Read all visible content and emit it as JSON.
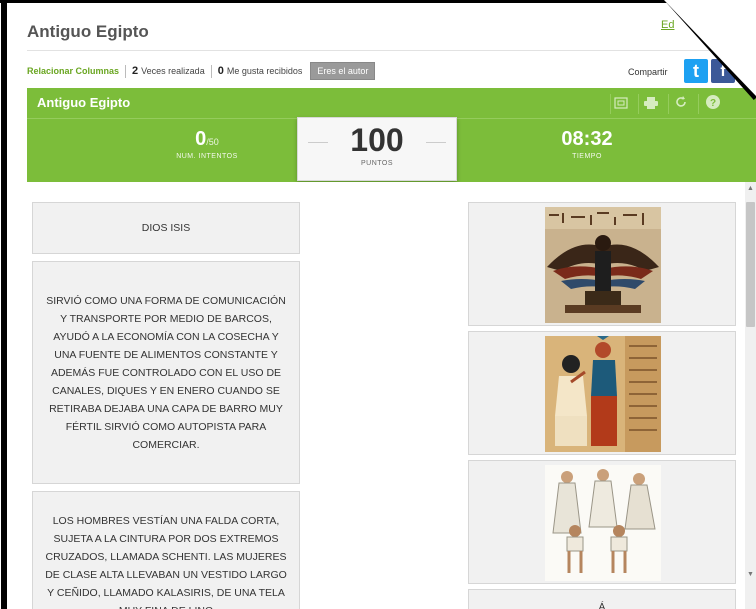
{
  "page": {
    "title": "Antiguo Egipto",
    "edit_link": "Ed"
  },
  "meta": {
    "activity_type": "Relacionar Columnas",
    "times_done": "2",
    "times_done_label": "Veces realizada",
    "likes": "0",
    "likes_label": "Me gusta recibidos",
    "author_button": "Eres el autor"
  },
  "share": {
    "label": "Compartir",
    "twitter_icon": "twitter-icon",
    "facebook_icon": "facebook-icon"
  },
  "game": {
    "title": "Antiguo Egipto",
    "attempts": {
      "value": "0",
      "max": "/50",
      "label": "NUM. INTENTOS"
    },
    "score": {
      "value": "100",
      "label": "PUNTOS"
    },
    "time": {
      "value": "08:32",
      "label": "TIEMPO"
    },
    "icons": [
      "fullscreen-icon",
      "print-icon",
      "restart-icon",
      "help-icon"
    ]
  },
  "left_column": [
    {
      "text": "DIOS ISIS"
    },
    {
      "text": "SIRVIÓ COMO UNA FORMA DE COMUNICACIÓN Y TRANSPORTE POR MEDIO DE BARCOS, AYUDÓ A LA ECONOMÍA CON LA COSECHA Y UNA FUENTE DE ALIMENTOS CONSTANTE Y ADEMÁS FUE CONTROLADO CON EL USO DE CANALES, DIQUES Y EN ENERO CUANDO SE RETIRABA DEJABA UNA CAPA DE BARRO MUY FÉRTIL SIRVIÓ COMO AUTOPISTA PARA COMERCIAR."
    },
    {
      "text": "LOS HOMBRES VESTÍAN UNA FALDA CORTA, SUJETA A LA CINTURA POR DOS EXTREMOS CRUZADOS, LLAMADA SCHENTI. LAS MUJERES DE CLASE ALTA LLEVABAN UN VESTIDO LARGO Y CEÑIDO, LLAMADO KALASIRIS, DE UNA TELA MUY FINA DE LINO"
    }
  ],
  "right_column": [
    {
      "image": "isis-winged-goddess-image"
    },
    {
      "image": "egyptian-painting-image"
    },
    {
      "image": "egyptian-clothing-image"
    },
    {
      "text": "Á"
    }
  ],
  "colors": {
    "accent": "#7cbd3a",
    "link": "#6aa621",
    "card_bg": "#f1f1f1"
  }
}
